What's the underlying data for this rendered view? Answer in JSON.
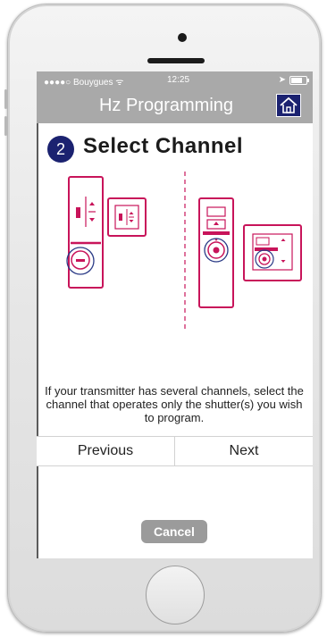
{
  "status_bar": {
    "carrier": "●●●●○ Bouygues ᯤ",
    "time": "12:25"
  },
  "nav": {
    "title": "Hz Programming",
    "home_icon": "home-icon"
  },
  "step": {
    "number": "2",
    "title": "Select Channel"
  },
  "instruction": "If your transmitter has several channels, select the channel that operates only the shutter(s) you wish to program.",
  "buttons": {
    "previous": "Previous",
    "next": "Next",
    "cancel": "Cancel"
  },
  "colors": {
    "accent": "#c8145a",
    "nav_blue": "#1b2270",
    "bar_gray": "#a9a9a9",
    "cancel_gray": "#9b9b9b"
  }
}
